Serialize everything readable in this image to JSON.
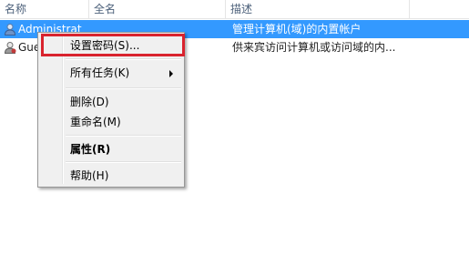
{
  "columns": {
    "name": "名称",
    "fullname": "全名",
    "description": "描述"
  },
  "users": [
    {
      "name": "Administrat",
      "fullname": "",
      "description": "管理计算机(域)的内置帐户",
      "selected": true
    },
    {
      "name": "Gue",
      "fullname": "",
      "description": "供来宾访问计算机或访问域的内...",
      "selected": false
    }
  ],
  "context_menu": {
    "items": [
      {
        "label": "设置密码(S)..."
      },
      {
        "label": "所有任务(K)",
        "submenu": true
      },
      {
        "label": "删除(D)"
      },
      {
        "label": "重命名(M)"
      },
      {
        "label": "属性(R)",
        "bold": true
      },
      {
        "label": "帮助(H)"
      }
    ]
  },
  "colors": {
    "selection": "#3399ff",
    "highlight_box": "#d9232e",
    "header_text": "#4c607a"
  }
}
